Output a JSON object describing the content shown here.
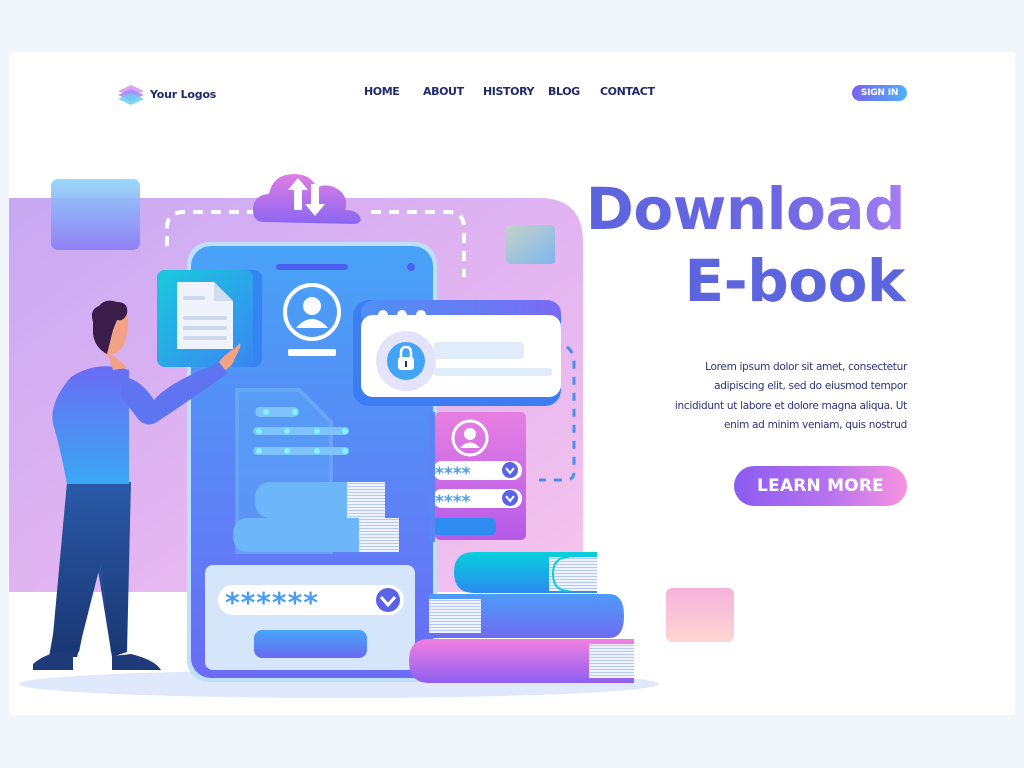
{
  "brand": {
    "logo_text": "Your Logos",
    "logo_icon": "stacked-layers-icon"
  },
  "nav": {
    "items": [
      {
        "label": "HOME"
      },
      {
        "label": "ABOUT"
      },
      {
        "label": "HISTORY"
      },
      {
        "label": "BLOG"
      },
      {
        "label": "CONTACT"
      }
    ],
    "signin_label": "SIGN IN"
  },
  "hero": {
    "title_line1": "Download",
    "title_line2": "E-book",
    "description": "Lorem ipsum dolor sit amet, consectetur adipiscing elit, sed do eiusmod tempor incididunt ut labore et dolore magna aliqua. Ut enim ad minim veniam, quis nostrud",
    "cta_label": "LEARN MORE"
  },
  "illustration": {
    "password_mask_large": "******",
    "password_mask_small_1": "****",
    "password_mask_small_2": "****",
    "icons": [
      "cloud-sync-icon",
      "document-icon",
      "user-avatar-icon",
      "padlock-icon",
      "dropdown-chevron-icon",
      "book-stack-icon"
    ]
  },
  "colors": {
    "page_bg": "#f1f6fd",
    "navy_text": "#1f2a6b",
    "title_blue": "#5c64de",
    "accent_purple": "#8a5cf0",
    "accent_pink": "#f793df",
    "accent_blue": "#4fb0fb"
  }
}
